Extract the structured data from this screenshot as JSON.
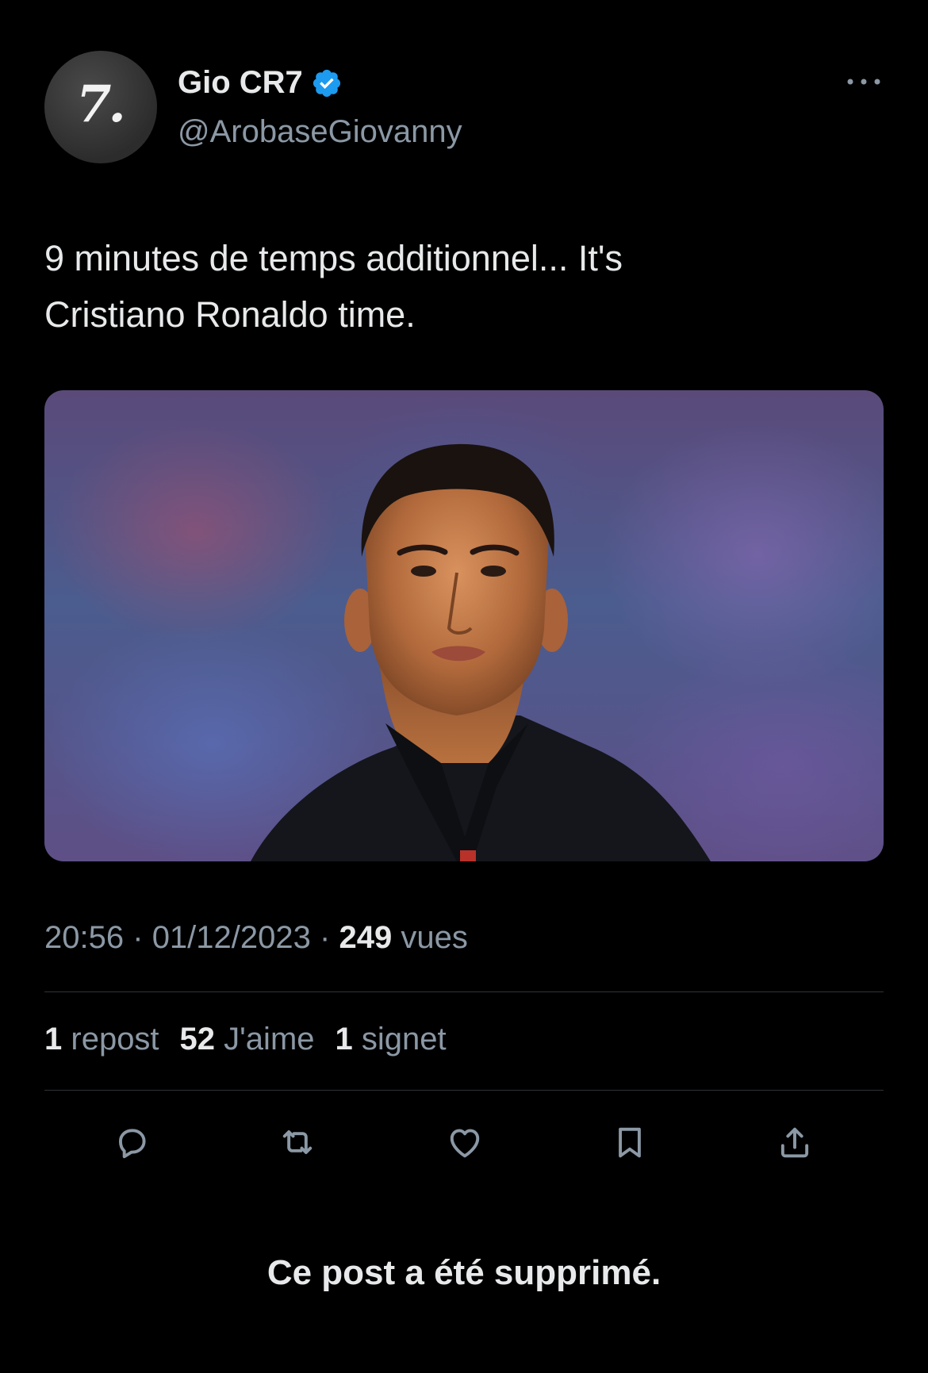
{
  "post": {
    "author": {
      "display_name": "Gio CR7",
      "handle": "@ArobaseGiovanny",
      "verified": true,
      "avatar_text": "7."
    },
    "text_line1": "9 minutes de temps additionnel... It's",
    "text_line2": "Cristiano Ronaldo time.",
    "media": {
      "alt": "Photo"
    },
    "meta": {
      "time": "20:56",
      "date": "01/12/2023",
      "separator": "·",
      "views_count": "249",
      "views_label": "vues"
    },
    "stats": {
      "reposts_count": "1",
      "reposts_label": "repost",
      "likes_count": "52",
      "likes_label": "J'aime",
      "bookmarks_count": "1",
      "bookmarks_label": "signet"
    },
    "actions": [
      "reply-icon",
      "repost-icon",
      "like-icon",
      "bookmark-icon",
      "share-icon"
    ]
  },
  "notice": {
    "deleted_text": "Ce post a été supprimé."
  },
  "colors": {
    "background": "#000000",
    "text_primary": "#e7e9ea",
    "text_secondary": "#8b98a5",
    "divider": "#2f3336",
    "verified_blue": "#1d9bf0"
  }
}
